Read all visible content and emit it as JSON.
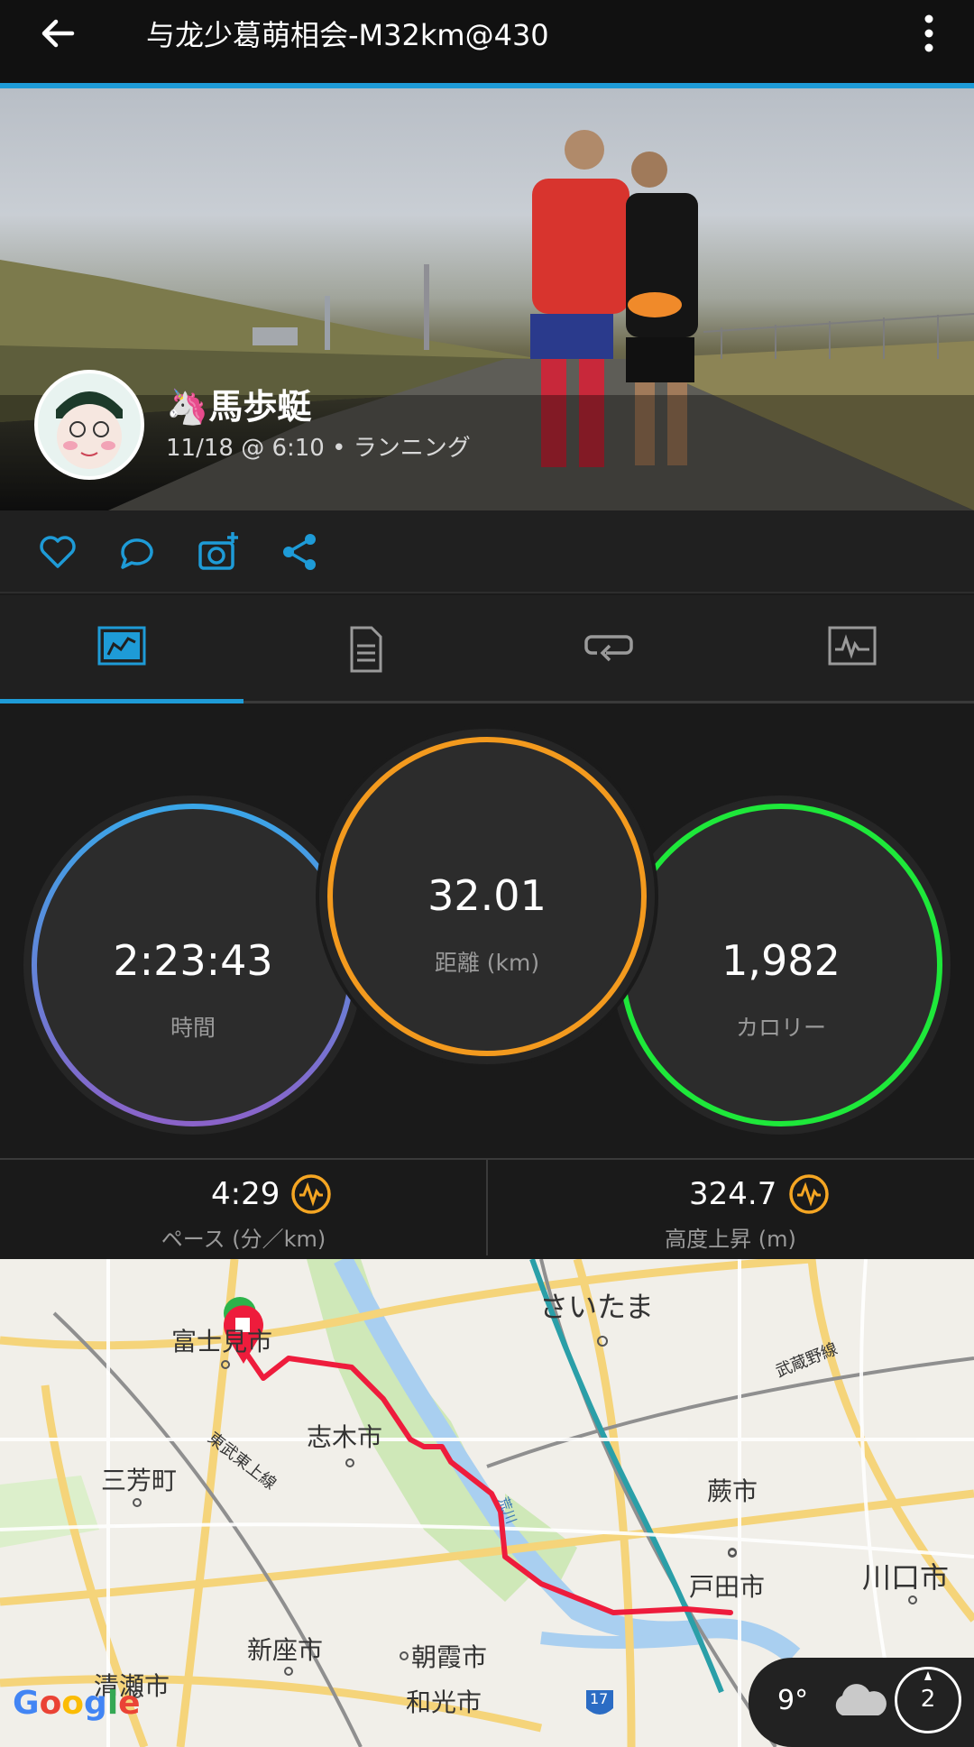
{
  "appbar": {
    "title": "与龙少葛萌相会-M32km@430",
    "back_icon": "arrow-left-icon",
    "menu_icon": "more-vertical-icon"
  },
  "activity": {
    "user_name": "🦄馬歩蜓",
    "subtitle": "11/18 @ 6:10 • ランニング"
  },
  "actions": [
    "heart-icon",
    "comment-icon",
    "add-photo-icon",
    "share-icon"
  ],
  "tabs": [
    {
      "name": "stats-tab",
      "icon": "chart-icon",
      "active": true
    },
    {
      "name": "details-tab",
      "icon": "document-icon",
      "active": false
    },
    {
      "name": "laps-tab",
      "icon": "loop-icon",
      "active": false
    },
    {
      "name": "graphs-tab",
      "icon": "graph-icon",
      "active": false
    }
  ],
  "stats": {
    "time": {
      "value": "2:23:43",
      "label": "時間"
    },
    "distance": {
      "value": "32.01",
      "label": "距離 (km)"
    },
    "calories": {
      "value": "1,982",
      "label": "カロリー"
    }
  },
  "substats": {
    "pace": {
      "value": "4:29",
      "label": "ペース (分／km)"
    },
    "elevation": {
      "value": "324.7",
      "label": "高度上昇 (m)"
    }
  },
  "colors": {
    "accent": "#1e9bd7",
    "time_ring_top": "#3aa6e8",
    "time_ring_bottom": "#8a63c9",
    "distance_ring": "#f39a1e",
    "calories_ring": "#1ee83a",
    "route": "#ee1c3c",
    "badge": "#f5a623"
  },
  "map": {
    "labels": {
      "fujimi": "富士見市",
      "saitama": "さいたま",
      "shiki": "志木市",
      "miyoshi": "三芳町",
      "warabi": "蕨市",
      "toda": "戸田市",
      "kawaguchi": "川口市",
      "niiza": "新座市",
      "asaka": "朝霞市",
      "kiyose": "清瀬市",
      "wako": "和光市",
      "tobu_tojo": "東武東上線",
      "musashino": "武蔵野線",
      "arakawa": "荒川",
      "route17": "17"
    },
    "attribution": "Google",
    "weather": {
      "temp": "9°",
      "icon": "cloud-icon",
      "wind": "2"
    }
  }
}
